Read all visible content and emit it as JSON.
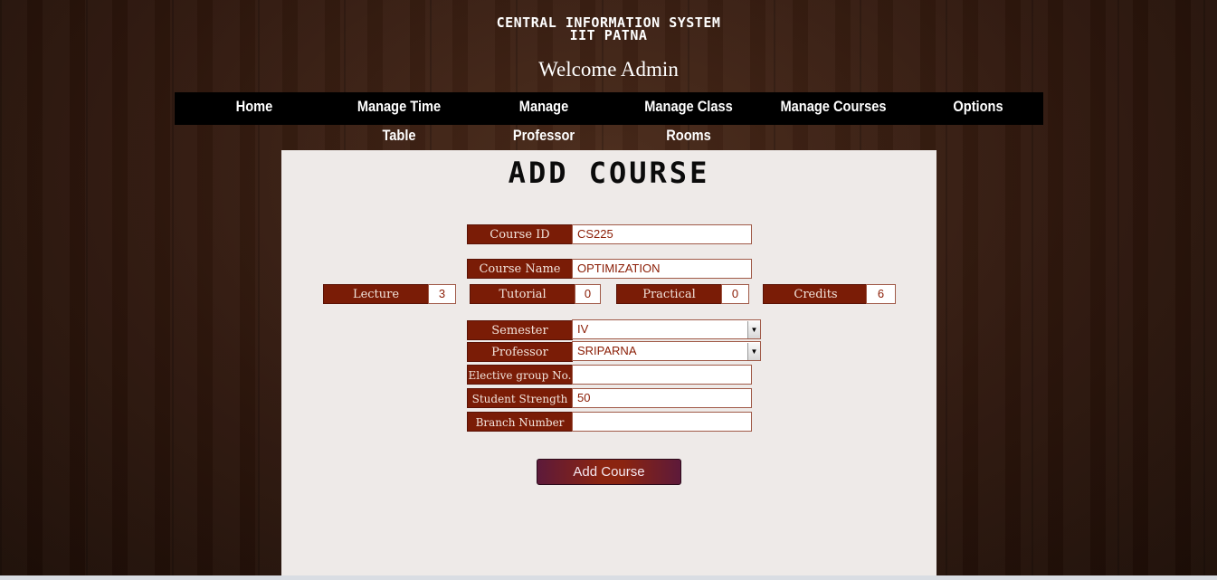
{
  "header": {
    "title_line1": "CENTRAL INFORMATION SYSTEM",
    "title_line2": "IIT PATNA",
    "welcome": "Welcome Admin"
  },
  "nav": {
    "items": [
      {
        "label": "Home"
      },
      {
        "label": "Manage Time Table"
      },
      {
        "label": "Manage Professor"
      },
      {
        "label": "Manage Class Rooms"
      },
      {
        "label": "Manage Courses"
      },
      {
        "label": "Options"
      }
    ]
  },
  "form": {
    "title": "ADD COURSE",
    "course_id": {
      "label": "Course ID",
      "value": "CS225"
    },
    "course_name": {
      "label": "Course Name",
      "value": "OPTIMIZATION"
    },
    "lecture": {
      "label": "Lecture",
      "value": "3"
    },
    "tutorial": {
      "label": "Tutorial",
      "value": "0"
    },
    "practical": {
      "label": "Practical",
      "value": "0"
    },
    "credits": {
      "label": "Credits",
      "value": "6"
    },
    "semester": {
      "label": "Semester",
      "value": "IV"
    },
    "professor": {
      "label": "Professor",
      "value": "SRIPARNA"
    },
    "elective_group": {
      "label": "Elective group No.",
      "value": ""
    },
    "student_strength": {
      "label": "Student Strength",
      "value": "50"
    },
    "branch_number": {
      "label": "Branch Number",
      "value": ""
    },
    "submit_label": "Add Course"
  },
  "colors": {
    "label_bg": "#7a1c06",
    "nav_bg": "#000000",
    "panel_bg": "#eeeae8"
  }
}
